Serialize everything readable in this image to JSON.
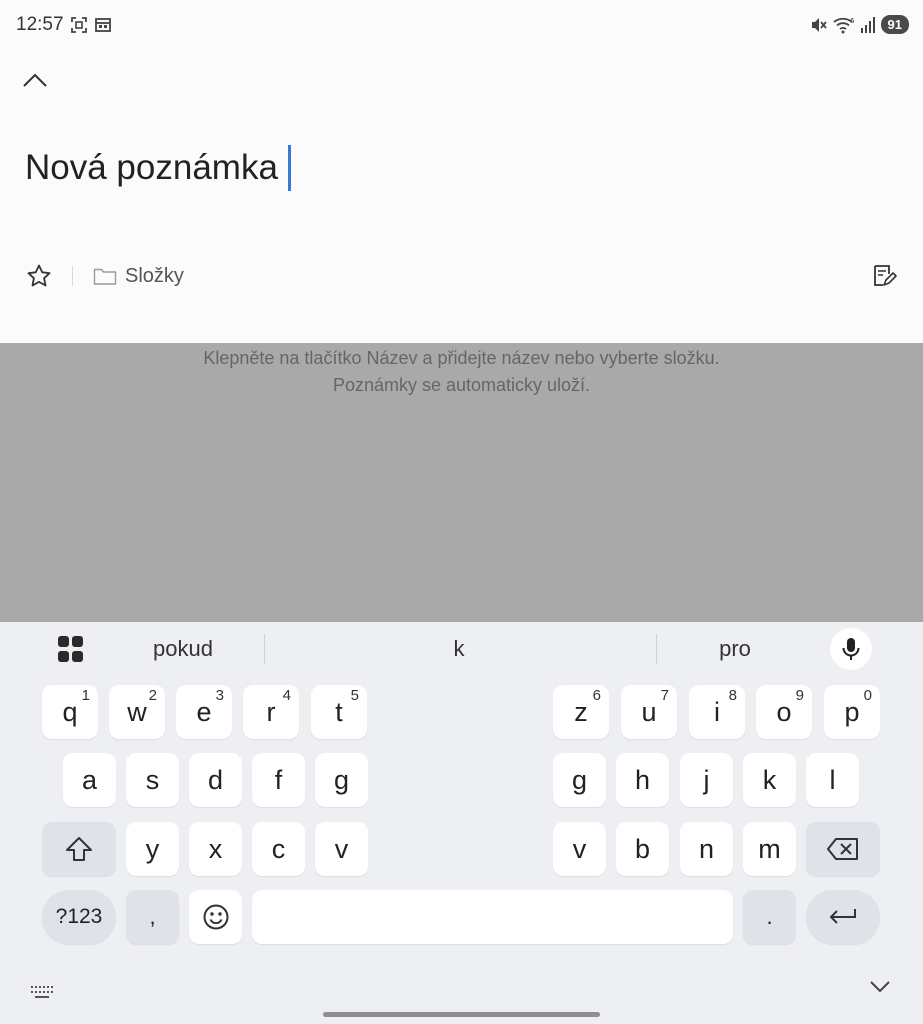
{
  "status_bar": {
    "time": "12:57",
    "battery": "91",
    "left_icons": [
      "screenshot-icon",
      "calendar-icon"
    ],
    "right_icons": [
      "mute-icon",
      "wifi-icon",
      "signal-icon"
    ]
  },
  "note": {
    "title": "Nová poznámka",
    "folder_label": "Složky"
  },
  "hint": {
    "line1": "Klepněte na tlačítko Název a přidejte název nebo vyberte složku.",
    "line2": "Poznámky se automaticky uloží."
  },
  "keyboard": {
    "suggestions": [
      "pokud",
      "k",
      "pro"
    ],
    "row1_left": [
      {
        "k": "q",
        "n": "1"
      },
      {
        "k": "w",
        "n": "2"
      },
      {
        "k": "e",
        "n": "3"
      },
      {
        "k": "r",
        "n": "4"
      },
      {
        "k": "t",
        "n": "5"
      }
    ],
    "row1_right": [
      {
        "k": "z",
        "n": "6"
      },
      {
        "k": "u",
        "n": "7"
      },
      {
        "k": "i",
        "n": "8"
      },
      {
        "k": "o",
        "n": "9"
      },
      {
        "k": "p",
        "n": "0"
      }
    ],
    "row2_left": [
      "a",
      "s",
      "d",
      "f",
      "g"
    ],
    "row2_right": [
      "g",
      "h",
      "j",
      "k",
      "l"
    ],
    "row3_left": [
      "y",
      "x",
      "c",
      "v"
    ],
    "row3_right": [
      "v",
      "b",
      "n",
      "m"
    ],
    "symbols_label": "?123",
    "comma_label": ",",
    "period_label": "."
  },
  "colors": {
    "caret": "#3a78d8",
    "overlay": "#a9a9a9",
    "keyboard_bg": "#eeeff2",
    "fn_key": "#dfe2e8"
  }
}
